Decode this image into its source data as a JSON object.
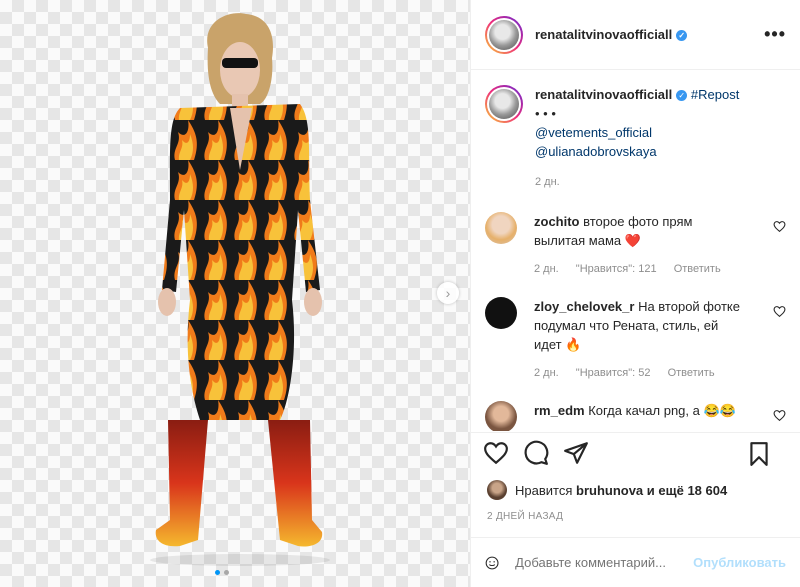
{
  "header": {
    "username": "renatalitvinova​officiall",
    "more_label": "•••"
  },
  "caption": {
    "username": "renatalitvinovaofficiall",
    "repost_tag": "#Repost",
    "dots": "• • •",
    "mention_1": "@vetements_official",
    "mention_2": "@ulianadobrovskaya",
    "time": "2 дн."
  },
  "comments": [
    {
      "username": "zochito",
      "text": "второе фото прям вылитая мама",
      "emoji": "❤️",
      "time": "2 дн.",
      "likes": "\"Нравится\": 121",
      "reply": "Ответить"
    },
    {
      "username": "zloy_chelovek_r",
      "text": "На второй фотке подумал что Рената, стиль, ей идет",
      "emoji": "🔥",
      "time": "2 дн.",
      "likes": "\"Нравится\": 52",
      "reply": "Ответить"
    },
    {
      "username": "rm_edm",
      "text": "Когда качал png, а",
      "emoji": "😂😂"
    }
  ],
  "likes": {
    "prefix": "Нравится",
    "user": "bruhunova",
    "suffix": "и ещё 18 604"
  },
  "date": "2 ДНЕЙ НАЗАД",
  "add_comment": {
    "placeholder": "Добавьте комментарий...",
    "publish": "Опубликовать"
  },
  "colors": {
    "accent": "#0095f6",
    "verified": "#3897f0",
    "heart_red": "#ed4956"
  }
}
